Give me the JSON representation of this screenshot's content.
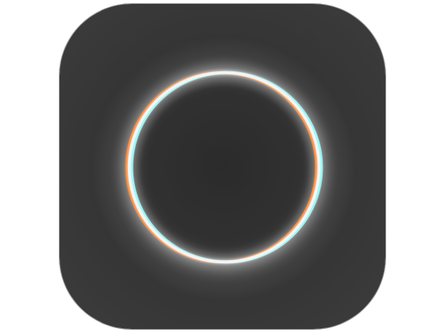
{
  "icon": {
    "name": "lens-ring-icon",
    "colors": {
      "background": "#3a3a3a",
      "background_center": "#2b2b2b",
      "glow": "#ffffff",
      "ring": "#f4f4f4",
      "ring_left_fringe": "#ff7a1a",
      "ring_right_fringe": "#7ef3ee",
      "border": "#9a9a9a"
    }
  }
}
